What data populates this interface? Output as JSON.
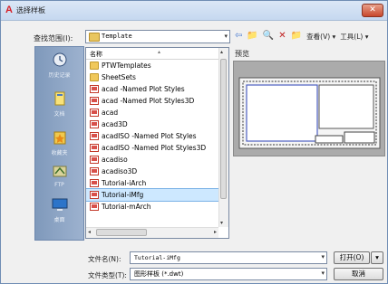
{
  "window": {
    "title": "选择样板",
    "close_icon": "✕"
  },
  "look_in": {
    "label": "查找范围(I):",
    "value": "Template"
  },
  "toolbar": {
    "back_icon": "⇦",
    "up_icon": "📁",
    "search_icon": "🔍",
    "delete_icon": "✕",
    "new_folder_icon": "📁",
    "views_label": "查看(V)",
    "tools_label": "工具(L)"
  },
  "places": [
    {
      "label": "历史记录",
      "icon": "history-icon"
    },
    {
      "label": "文档",
      "icon": "documents-icon"
    },
    {
      "label": "收藏夹",
      "icon": "favorites-icon"
    },
    {
      "label": "FTP",
      "icon": "ftp-icon"
    },
    {
      "label": "桌面",
      "icon": "desktop-icon"
    }
  ],
  "list": {
    "header": "名称",
    "items": [
      {
        "name": "PTWTemplates",
        "type": "folder"
      },
      {
        "name": "SheetSets",
        "type": "folder"
      },
      {
        "name": "acad -Named Plot Styles",
        "type": "dwt"
      },
      {
        "name": "acad -Named Plot Styles3D",
        "type": "dwt"
      },
      {
        "name": "acad",
        "type": "dwt"
      },
      {
        "name": "acad3D",
        "type": "dwt"
      },
      {
        "name": "acadISO -Named Plot Styles",
        "type": "dwt"
      },
      {
        "name": "acadISO -Named Plot Styles3D",
        "type": "dwt"
      },
      {
        "name": "acadiso",
        "type": "dwt"
      },
      {
        "name": "acadiso3D",
        "type": "dwt"
      },
      {
        "name": "Tutorial-iArch",
        "type": "dwt"
      },
      {
        "name": "Tutorial-iMfg",
        "type": "dwt",
        "selected": true
      },
      {
        "name": "Tutorial-mArch",
        "type": "dwt"
      }
    ]
  },
  "preview": {
    "label": "预览"
  },
  "file_name": {
    "label": "文件名(N):",
    "value": "Tutorial-iMfg"
  },
  "file_type": {
    "label": "文件类型(T):",
    "value": "图形样板 (*.dwt)"
  },
  "buttons": {
    "open": "打开(O)",
    "cancel": "取消"
  }
}
